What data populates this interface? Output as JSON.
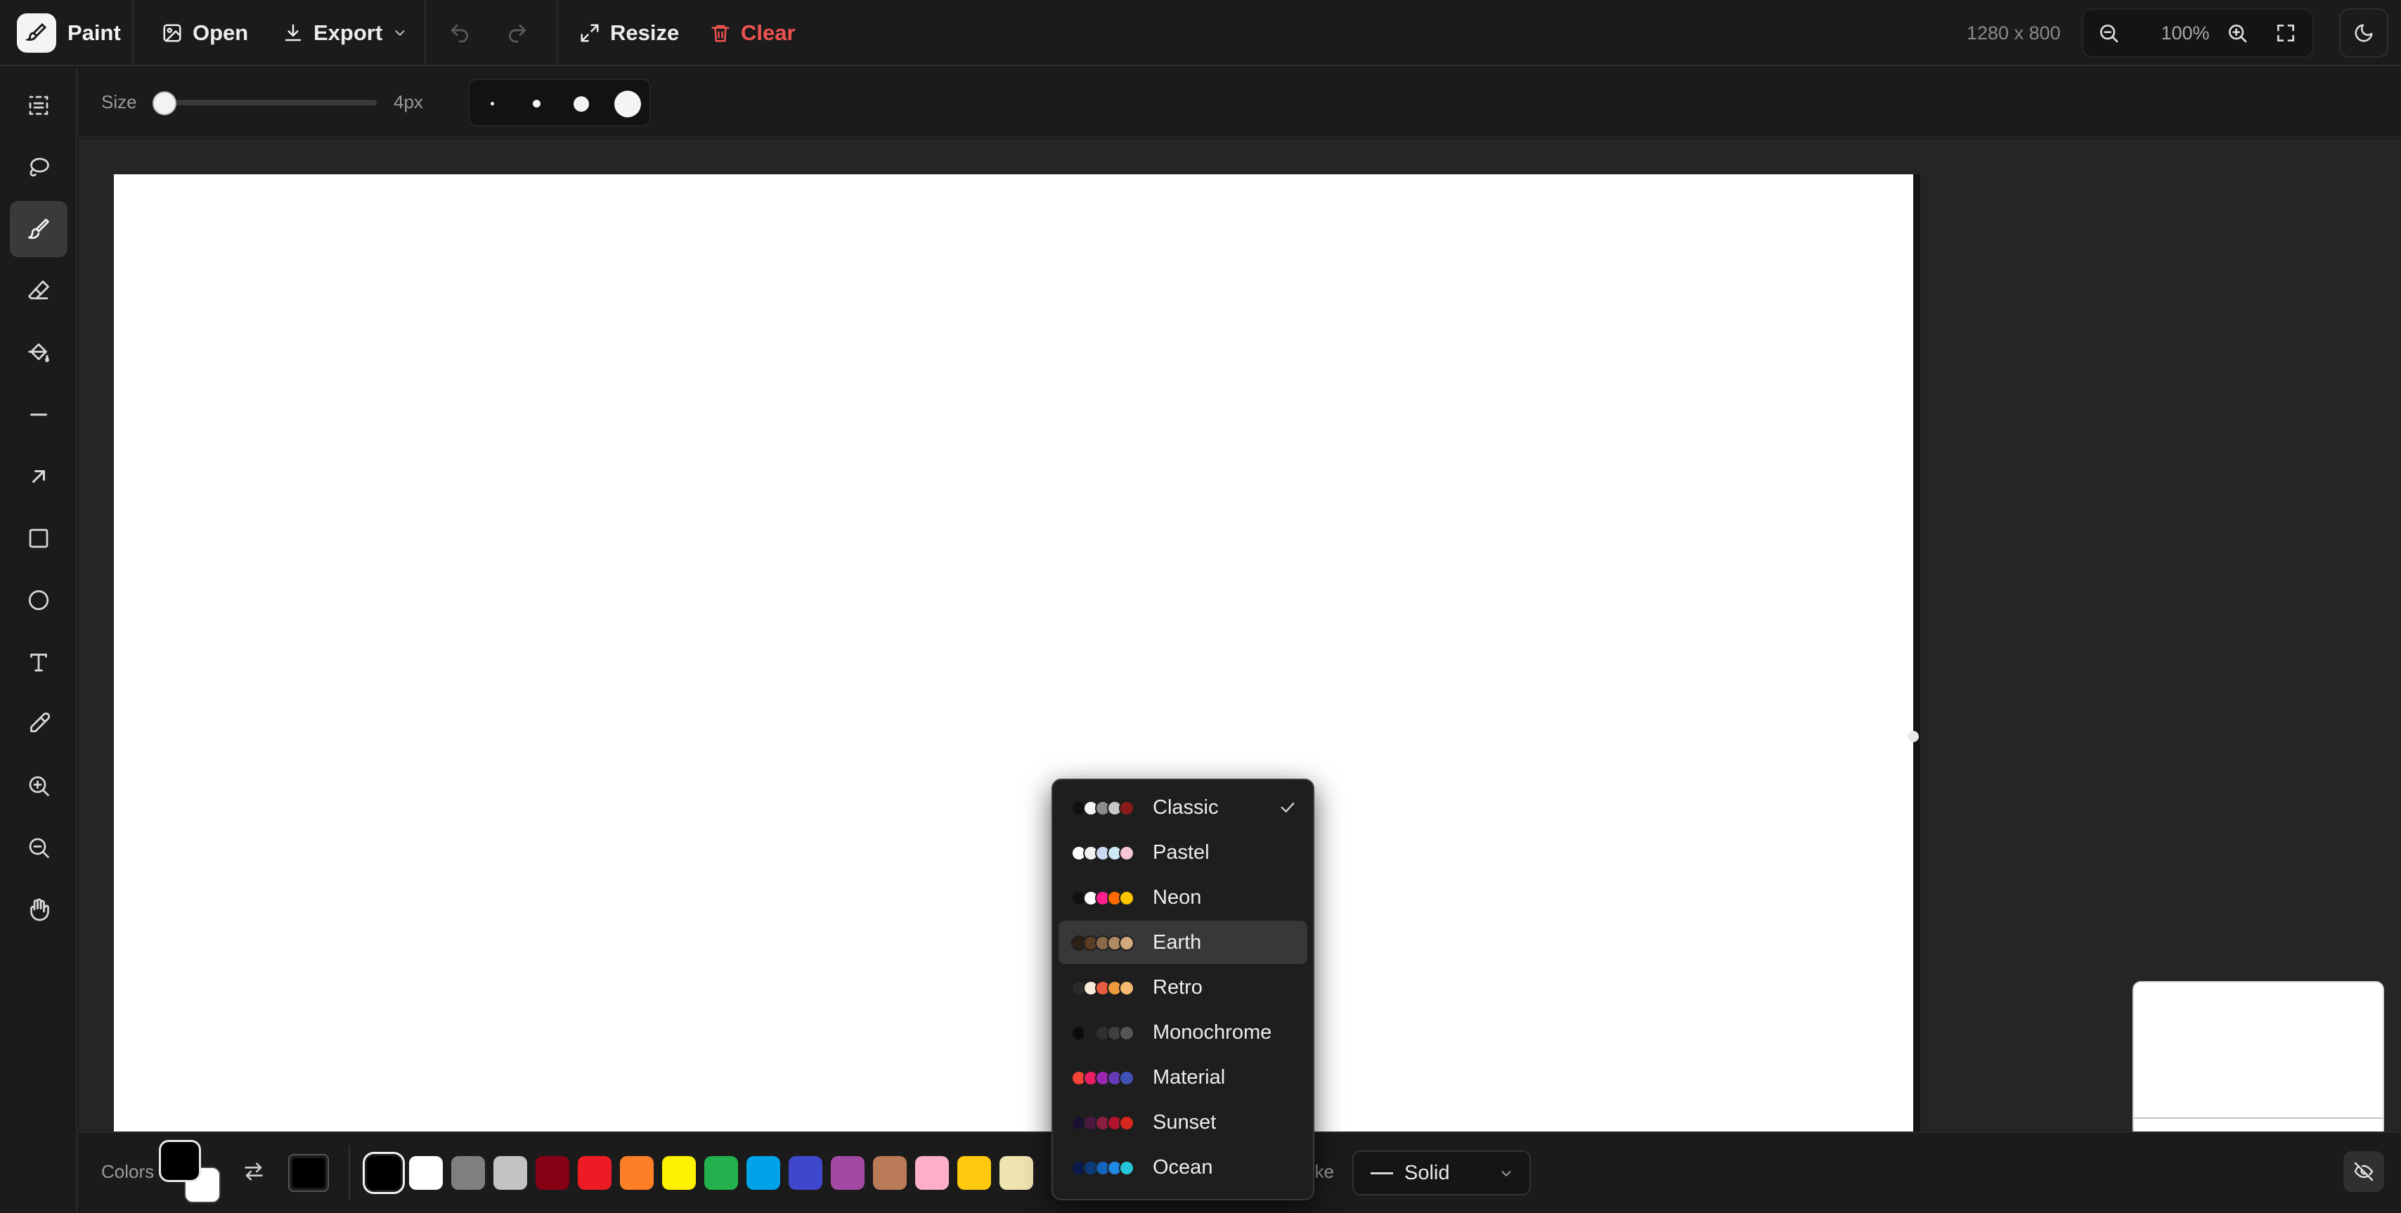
{
  "app": {
    "title": "Paint"
  },
  "toolbar": {
    "open_label": "Open",
    "export_label": "Export",
    "resize_label": "Resize",
    "clear_label": "Clear",
    "canvas_size": "1280 x 800",
    "zoom_level": "100%",
    "clear_color": "#ef5350"
  },
  "tools": [
    {
      "name": "select-tool",
      "icon": "select-icon"
    },
    {
      "name": "lasso-tool",
      "icon": "lasso-icon"
    },
    {
      "name": "brush-tool",
      "icon": "brush-icon",
      "active": true
    },
    {
      "name": "eraser-tool",
      "icon": "eraser-icon"
    },
    {
      "name": "fill-tool",
      "icon": "paint-bucket-icon"
    },
    {
      "name": "line-tool",
      "icon": "line-icon"
    },
    {
      "name": "arrow-tool",
      "icon": "arrow-icon"
    },
    {
      "name": "rectangle-tool",
      "icon": "rectangle-icon"
    },
    {
      "name": "ellipse-tool",
      "icon": "circle-icon"
    },
    {
      "name": "text-tool",
      "icon": "text-icon"
    },
    {
      "name": "eyedropper-tool",
      "icon": "eyedropper-icon"
    },
    {
      "name": "zoom-in-tool",
      "icon": "zoom-in-icon"
    },
    {
      "name": "zoom-out-tool",
      "icon": "zoom-out-icon"
    },
    {
      "name": "pan-tool",
      "icon": "hand-icon"
    }
  ],
  "options": {
    "size_label": "Size",
    "size_value": "4px",
    "size_fraction": 0.05
  },
  "colors": {
    "label": "Colors",
    "primary": "#000000",
    "secondary": "#ffffff",
    "palette": [
      "#000000",
      "#ffffff",
      "#7f7f7f",
      "#c3c3c3",
      "#880015",
      "#ed1c24",
      "#ff7f27",
      "#fff200",
      "#22b14c",
      "#00a2e8",
      "#3f48cc",
      "#a349a4",
      "#b97a57",
      "#ffaec9",
      "#ffc90e",
      "#efe4b0"
    ],
    "selected_index": 0
  },
  "stroke": {
    "label_partial": "oke",
    "value": "Solid"
  },
  "palette_menu": {
    "selected": "Classic",
    "hovered": "Earth",
    "items": [
      {
        "label": "Classic",
        "colors": [
          "#111111",
          "#f5f5f5",
          "#8c8c8c",
          "#c8c8c8",
          "#8b1a1a"
        ]
      },
      {
        "label": "Pastel",
        "colors": [
          "#ffffff",
          "#f1f1f1",
          "#c9d9f1",
          "#cde9f5",
          "#f6c6d6"
        ]
      },
      {
        "label": "Neon",
        "colors": [
          "#111111",
          "#ffffff",
          "#ff1f8e",
          "#ff6a00",
          "#ffc400"
        ]
      },
      {
        "label": "Earth",
        "colors": [
          "#2b2117",
          "#5a3d26",
          "#8b6a4a",
          "#b08a63",
          "#d3a77c"
        ]
      },
      {
        "label": "Retro",
        "colors": [
          "#2a2a2a",
          "#f6ecd7",
          "#e85c41",
          "#f09a3e",
          "#f5b971"
        ]
      },
      {
        "label": "Monochrome",
        "colors": [
          "#0b0b0b",
          "#1e1e1e",
          "#2f2f2f",
          "#3f3f3f",
          "#555555"
        ]
      },
      {
        "label": "Material",
        "colors": [
          "#f44336",
          "#e91e63",
          "#9c27b0",
          "#673ab7",
          "#3f51b5"
        ]
      },
      {
        "label": "Sunset",
        "colors": [
          "#1a1030",
          "#4a1942",
          "#8b1e3f",
          "#b3122e",
          "#d7261e"
        ]
      },
      {
        "label": "Ocean",
        "colors": [
          "#0a1a4a",
          "#0d3b7a",
          "#1565c0",
          "#1e88e5",
          "#26c6da"
        ]
      }
    ]
  }
}
